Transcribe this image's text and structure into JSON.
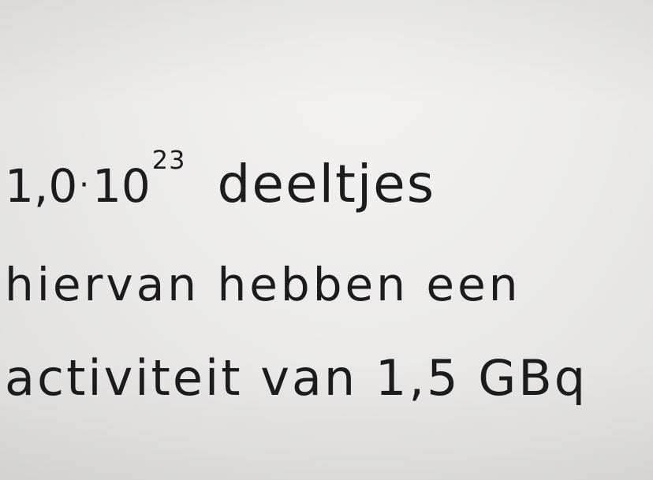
{
  "note": {
    "line1": {
      "mantissa": "1,0",
      "times": "·",
      "base": "10",
      "exponent": "23",
      "word": "deeltjes"
    },
    "line2": "hiervan hebben een",
    "line3": "activiteit van 1,5 GBq"
  }
}
